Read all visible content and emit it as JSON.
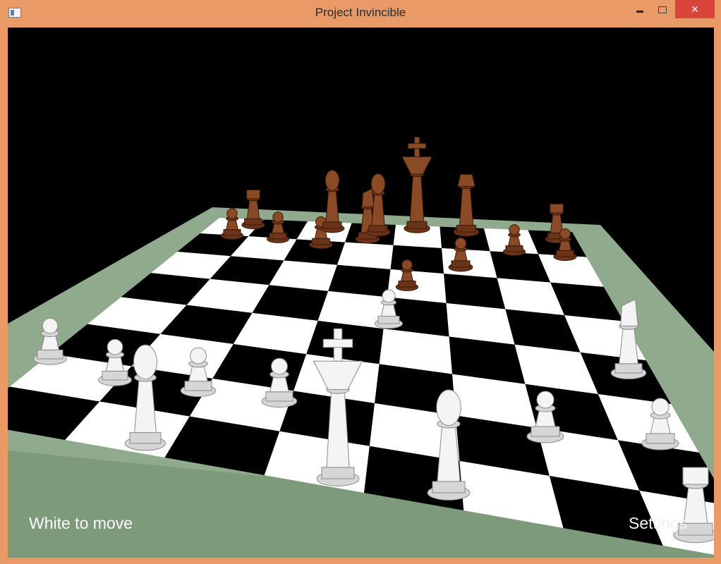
{
  "window": {
    "title": "Project Invincible",
    "icon": "app-window-icon",
    "controls": {
      "minimize": "minimize-icon",
      "maximize": "maximize-icon",
      "close": "×"
    }
  },
  "game": {
    "status_text": "White to move",
    "settings_label": "Settings",
    "colors": {
      "background": "#000000",
      "board_frame": "#8faa8c",
      "dark_square": "#000000",
      "light_square": "#ffffff",
      "white_pieces": "#d8d8d8",
      "black_pieces": "#6b3418"
    }
  }
}
